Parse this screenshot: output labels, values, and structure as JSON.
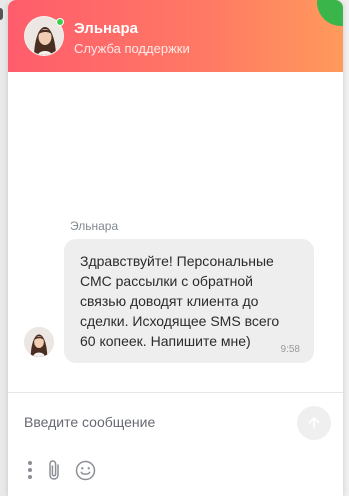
{
  "header": {
    "agent_name": "Эльнара",
    "agent_role": "Служба поддержки"
  },
  "message": {
    "sender": "Эльнара",
    "text": "Здравствуйте! Персональные\nСМС рассылки с обратной\nсвязью доводят клиента до\nсделки. Исходящее SMS всего\n60 копеек. Напишите мне)",
    "time": "9:58"
  },
  "composer": {
    "placeholder": "Введите сообщение",
    "value": ""
  },
  "icons": {
    "send": "arrow-up-icon",
    "menu": "more-vertical-icon",
    "attach": "paperclip-icon",
    "emoji": "smile-icon"
  },
  "colors": {
    "header_gradient_start": "#ff5c6c",
    "header_gradient_end": "#ff9a5c",
    "online": "#3ccf4e",
    "corner_badge": "#39b54a",
    "bubble_bg": "#eeeeee"
  }
}
